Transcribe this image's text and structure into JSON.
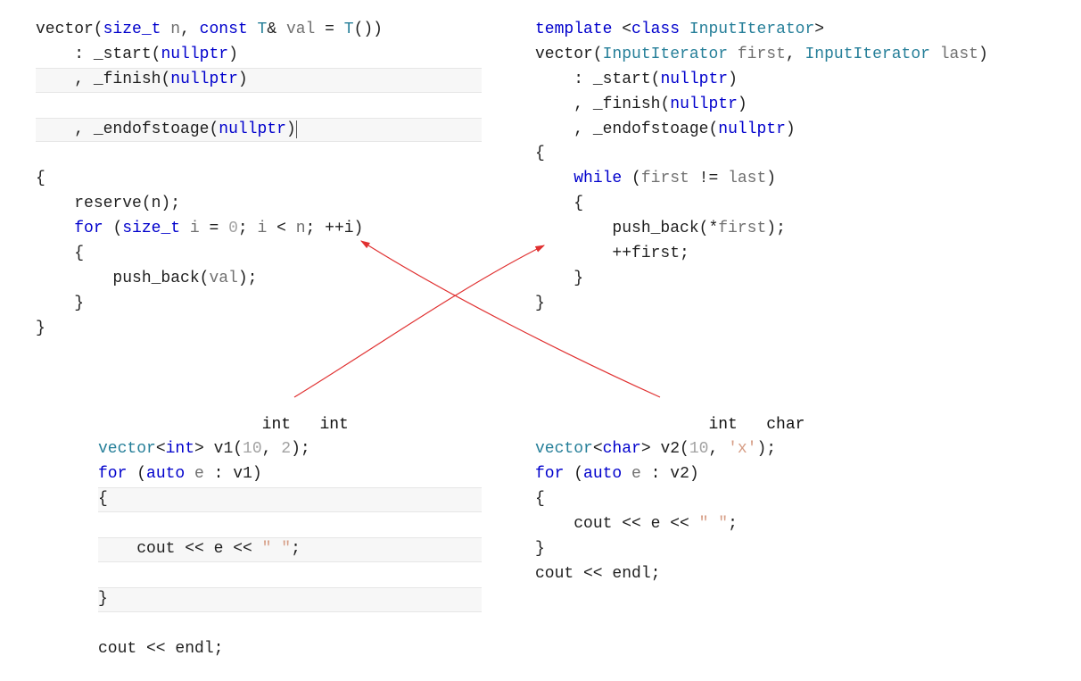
{
  "left_ctor": {
    "sig_pre": "vector(",
    "size_t": "size_t",
    "n": "n",
    "comma": ", ",
    "const": "const",
    "T": "T",
    "amp": "&",
    "val": "val",
    "eq": " = ",
    "Tctor": "T",
    "paren_close": "())",
    "init1_colon": ": ",
    "start": "_start",
    "np": "nullptr",
    "init_comma": ", ",
    "finish": "_finish",
    "endof": "_endofstoage",
    "body_reserve": "reserve(n);",
    "for": "for",
    "for_sig1": "(",
    "i": "i",
    "zero": "0",
    "semi": "; ",
    "ipp": "++i)",
    "push_back": "push_back(",
    "val2": "val",
    "pb_close": ");"
  },
  "right_ctor": {
    "template": "template",
    "open_ang": " <",
    "class": "class",
    "InputIterator": "InputIterator",
    "close_ang": ">",
    "vector": "vector(",
    "first": "first",
    "last": "last",
    "init1_colon": ": ",
    "start": "_start",
    "np": "nullptr",
    "init_comma": ", ",
    "finish": "_finish",
    "endof": "_endofstoage",
    "while": "while",
    "while_cond_open": " (",
    "neq": " != ",
    "while_cond_close": ")",
    "push_back": "push_back(*",
    "pb_close": ");",
    "inc_first": "++first;"
  },
  "label_left_a": "int",
  "label_left_b": "int",
  "label_right_a": "int",
  "label_right_b": "char",
  "ex_left": {
    "decl_type": "vector",
    "int": "int",
    "v1": "v1(",
    "arg1": "10",
    "arg2": "2",
    "close": ");",
    "for": "for",
    "auto": "auto",
    "e": "e",
    "rng": " : v1)",
    "cout": "cout << e << ",
    "space_str": "\" \"",
    "semi": ";",
    "endl": "cout << endl;"
  },
  "ex_right": {
    "decl_type": "vector",
    "char": "char",
    "v2": "v2(",
    "arg1": "10",
    "arg2": "'x'",
    "close": ");",
    "for": "for",
    "auto": "auto",
    "e": "e",
    "rng": " : v2)",
    "cout": "cout << e << ",
    "space_str": "\" \"",
    "semi": ";",
    "endl": "cout << endl;"
  }
}
